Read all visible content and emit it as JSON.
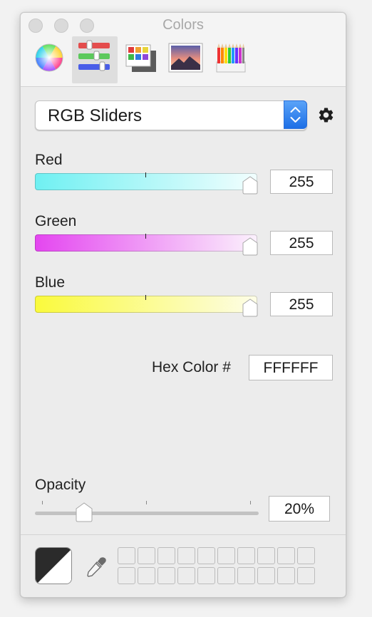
{
  "window": {
    "title": "Colors"
  },
  "toolbar": {
    "tabs": [
      {
        "id": "color-wheel",
        "icon": "color-wheel-icon"
      },
      {
        "id": "color-sliders",
        "icon": "sliders-icon",
        "selected": true
      },
      {
        "id": "color-palettes",
        "icon": "palettes-icon"
      },
      {
        "id": "image-palettes",
        "icon": "image-palette-icon"
      },
      {
        "id": "pencils",
        "icon": "pencils-icon"
      }
    ]
  },
  "mode_popup": {
    "selected": "RGB Sliders"
  },
  "sliders": [
    {
      "label": "Red",
      "value": "255",
      "gradient": [
        "#6ff0f2",
        "#f2fefe"
      ]
    },
    {
      "label": "Green",
      "value": "255",
      "gradient": [
        "#e446f0",
        "#fbf1fc"
      ]
    },
    {
      "label": "Blue",
      "value": "255",
      "gradient": [
        "#fafa3c",
        "#fdfde7"
      ]
    }
  ],
  "hex": {
    "label": "Hex Color #",
    "value": "FFFFFF"
  },
  "opacity": {
    "label": "Opacity",
    "value": "20%",
    "fraction": 0.2
  },
  "colors": {
    "accent": "#1d6fe6",
    "swatch_dark": "#2b2b2b",
    "swatch_light": "#ffffff"
  }
}
